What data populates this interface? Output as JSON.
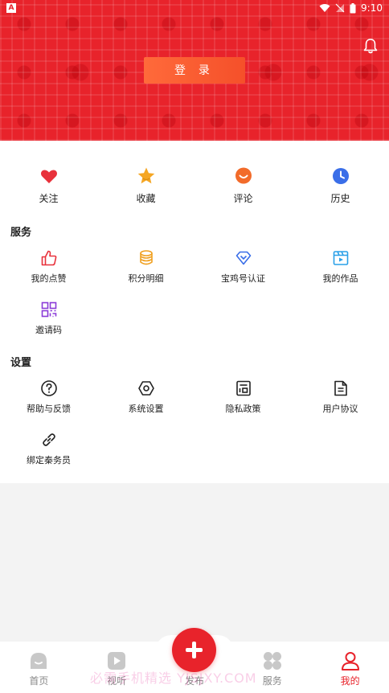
{
  "status_bar": {
    "time": "9:10",
    "app_badge": "A"
  },
  "header": {
    "login_label": "登 录"
  },
  "quick_actions": [
    {
      "label": "关注",
      "icon": "heart-icon",
      "color": "#e8313b"
    },
    {
      "label": "收藏",
      "icon": "star-icon",
      "color": "#f5a623"
    },
    {
      "label": "评论",
      "icon": "comment-icon",
      "color": "#f26b2a"
    },
    {
      "label": "历史",
      "icon": "clock-icon",
      "color": "#3a6ee8"
    }
  ],
  "services": {
    "title": "服务",
    "items": [
      {
        "label": "我的点赞",
        "icon": "thumbs-up-icon",
        "color": "#e8313b"
      },
      {
        "label": "积分明细",
        "icon": "coins-icon",
        "color": "#f0a020"
      },
      {
        "label": "宝鸡号认证",
        "icon": "diamond-icon",
        "color": "#3a6ee8"
      },
      {
        "label": "我的作品",
        "icon": "video-icon",
        "color": "#2aa0e8"
      },
      {
        "label": "邀请码",
        "icon": "qr-code-icon",
        "color": "#8a3ad8"
      }
    ]
  },
  "settings": {
    "title": "设置",
    "items": [
      {
        "label": "帮助与反馈",
        "icon": "help-icon"
      },
      {
        "label": "系统设置",
        "icon": "settings-icon"
      },
      {
        "label": "隐私政策",
        "icon": "privacy-icon"
      },
      {
        "label": "用户协议",
        "icon": "document-icon"
      },
      {
        "label": "绑定秦务员",
        "icon": "link-icon"
      }
    ]
  },
  "bottom_nav": [
    {
      "label": "首页",
      "icon": "home-icon"
    },
    {
      "label": "视听",
      "icon": "play-icon"
    },
    {
      "label": "发布",
      "icon": "plus-icon"
    },
    {
      "label": "服务",
      "icon": "apps-icon"
    },
    {
      "label": "我的",
      "icon": "user-icon",
      "active": true
    }
  ],
  "watermark": "必需手机精选 YJSJXY.COM",
  "colors": {
    "brand_red": "#e8232b",
    "login_orange": "#ff6a3a"
  }
}
